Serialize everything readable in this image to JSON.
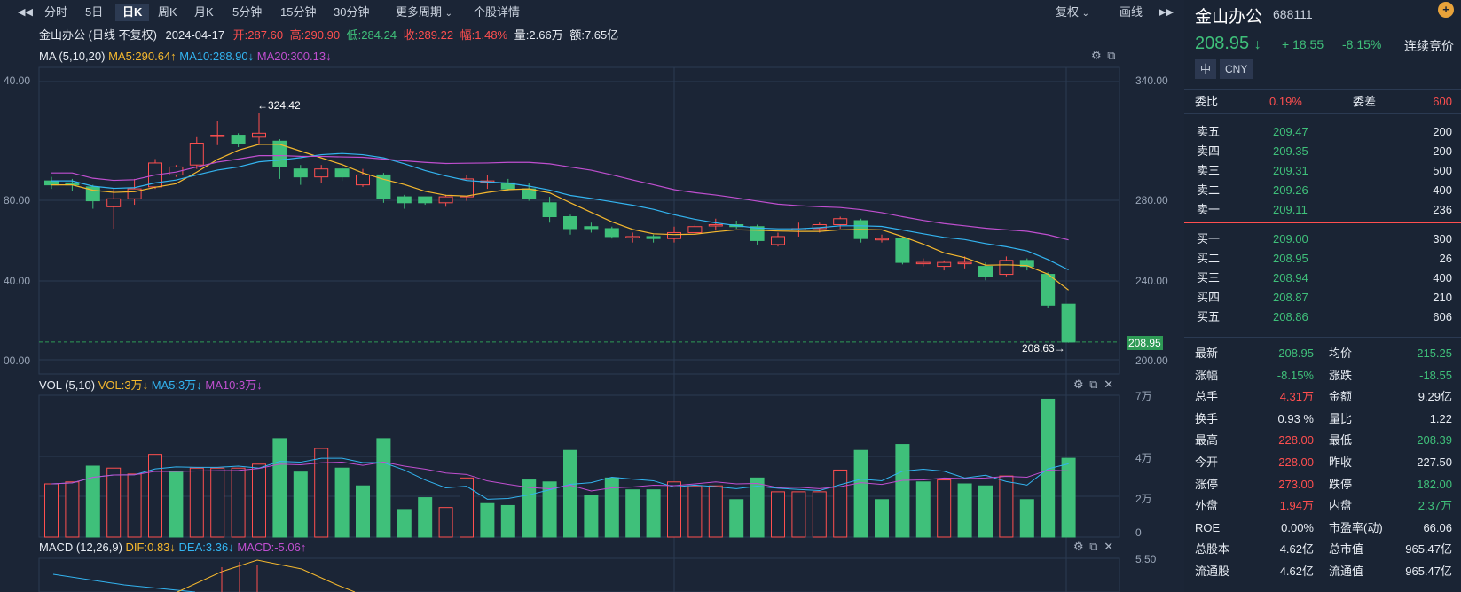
{
  "toolbar": {
    "tabs": [
      "分时",
      "5日",
      "日K",
      "周K",
      "月K",
      "5分钟",
      "15分钟",
      "30分钟"
    ],
    "more_period": "更多周期",
    "detail": "个股详情",
    "fuquan": "复权",
    "huaxian": "画线"
  },
  "info": {
    "name": "金山办公",
    "mode": "(日线 不复权)",
    "date": "2024-04-17",
    "open": "开:287.60",
    "high": "高:290.90",
    "low": "低:284.24",
    "close": "收:289.22",
    "amp": "幅:1.48%",
    "vol": "量:2.66万",
    "amt": "额:7.65亿"
  },
  "ma_header": {
    "title": "MA (5,10,20)",
    "ma5": "MA5:290.64↑",
    "ma10": "MA10:288.90↓",
    "ma20": "MA20:300.13↓"
  },
  "vol_header": {
    "title": "VOL (5,10)",
    "vol": "VOL:3万↓",
    "ma5": "MA5:3万↓",
    "ma10": "MA10:3万↓"
  },
  "macd_header": {
    "title": "MACD (12,26,9)",
    "dif": "DIF:0.83↓",
    "dea": "DEA:3.36↓",
    "macd": "MACD:-5.06↑"
  },
  "price_axis": {
    "right": [
      "340.00",
      "280.00",
      "240.00",
      "200.00"
    ],
    "left": [
      "40.00",
      "80.00",
      "40.00",
      "00.00"
    ]
  },
  "vol_axis": [
    "7万",
    "4万",
    "2万",
    "0"
  ],
  "macd_axis": [
    "5.50"
  ],
  "annotations": {
    "high_label": "←324.42",
    "low_label": "208.63→",
    "last_price_tag": "208.95"
  },
  "colors": {
    "up": "#ff4f4f",
    "down": "#3fc07a",
    "ma5": "#f5b82e",
    "ma10": "#33b4f0",
    "ma20": "#c04fd0",
    "bg": "#1b2536"
  },
  "candles": [
    {
      "o": 290,
      "c": 288,
      "h": 292,
      "l": 286
    },
    {
      "o": 289,
      "c": 288,
      "h": 291,
      "l": 285
    },
    {
      "o": 287,
      "c": 280,
      "h": 288,
      "l": 276
    },
    {
      "o": 277,
      "c": 281,
      "h": 286,
      "l": 266
    },
    {
      "o": 281,
      "c": 286,
      "h": 291,
      "l": 278
    },
    {
      "o": 287,
      "c": 299,
      "h": 301,
      "l": 286
    },
    {
      "o": 293,
      "c": 297,
      "h": 298,
      "l": 292
    },
    {
      "o": 298,
      "c": 309,
      "h": 312,
      "l": 296
    },
    {
      "o": 313,
      "c": 313,
      "h": 320,
      "l": 308
    },
    {
      "o": 313,
      "c": 309,
      "h": 314,
      "l": 307
    },
    {
      "o": 312,
      "c": 314,
      "h": 324.42,
      "l": 308
    },
    {
      "o": 310,
      "c": 297,
      "h": 311,
      "l": 291
    },
    {
      "o": 296,
      "c": 292,
      "h": 298,
      "l": 288
    },
    {
      "o": 292,
      "c": 296,
      "h": 298,
      "l": 289
    },
    {
      "o": 296,
      "c": 292,
      "h": 299,
      "l": 290
    },
    {
      "o": 288,
      "c": 293,
      "h": 296,
      "l": 287
    },
    {
      "o": 293,
      "c": 281,
      "h": 294,
      "l": 279
    },
    {
      "o": 282,
      "c": 279,
      "h": 283,
      "l": 276
    },
    {
      "o": 282,
      "c": 279,
      "h": 281,
      "l": 278
    },
    {
      "o": 279,
      "c": 282,
      "h": 283,
      "l": 277
    },
    {
      "o": 282,
      "c": 291,
      "h": 293,
      "l": 280
    },
    {
      "o": 290,
      "c": 290,
      "h": 293,
      "l": 286
    },
    {
      "o": 289,
      "c": 286,
      "h": 291,
      "l": 285
    },
    {
      "o": 286,
      "c": 281,
      "h": 289,
      "l": 280
    },
    {
      "o": 279,
      "c": 272,
      "h": 282,
      "l": 269
    },
    {
      "o": 272,
      "c": 266,
      "h": 273,
      "l": 263
    },
    {
      "o": 267,
      "c": 266,
      "h": 269,
      "l": 264
    },
    {
      "o": 266,
      "c": 262,
      "h": 267,
      "l": 261
    },
    {
      "o": 262,
      "c": 262,
      "h": 264,
      "l": 259
    },
    {
      "o": 262,
      "c": 261,
      "h": 263,
      "l": 259
    },
    {
      "o": 261,
      "c": 264,
      "h": 267,
      "l": 259
    },
    {
      "o": 264,
      "c": 267,
      "h": 268,
      "l": 263
    },
    {
      "o": 268,
      "c": 268,
      "h": 271,
      "l": 265
    },
    {
      "o": 268,
      "c": 267,
      "h": 270,
      "l": 266
    },
    {
      "o": 267,
      "c": 260,
      "h": 268,
      "l": 258
    },
    {
      "o": 258,
      "c": 262,
      "h": 264,
      "l": 257
    },
    {
      "o": 266,
      "c": 266,
      "h": 269,
      "l": 262
    },
    {
      "o": 266,
      "c": 268,
      "h": 269,
      "l": 264
    },
    {
      "o": 268,
      "c": 271,
      "h": 272,
      "l": 266
    },
    {
      "o": 270,
      "c": 261,
      "h": 271,
      "l": 259
    },
    {
      "o": 261,
      "c": 261,
      "h": 263,
      "l": 259
    },
    {
      "o": 261,
      "c": 249,
      "h": 262,
      "l": 248
    },
    {
      "o": 249,
      "c": 249,
      "h": 251,
      "l": 247
    },
    {
      "o": 247,
      "c": 249,
      "h": 250,
      "l": 245
    },
    {
      "o": 249,
      "c": 249,
      "h": 252,
      "l": 246
    },
    {
      "o": 247,
      "c": 242,
      "h": 249,
      "l": 240
    },
    {
      "o": 243,
      "c": 250,
      "h": 252,
      "l": 242
    },
    {
      "o": 250,
      "c": 247,
      "h": 251,
      "l": 245
    },
    {
      "o": 243,
      "c": 227.5,
      "h": 244,
      "l": 226
    },
    {
      "o": 228,
      "c": 208.95,
      "h": 228,
      "l": 208.63
    }
  ],
  "volumes": [
    2.7,
    2.8,
    3.6,
    3.5,
    3.2,
    4.2,
    3.3,
    3.5,
    3.5,
    3.5,
    3.7,
    5.0,
    3.3,
    4.5,
    3.5,
    2.6,
    5.0,
    1.4,
    2.0,
    1.5,
    3.0,
    1.7,
    1.6,
    2.9,
    2.8,
    4.4,
    2.1,
    3.0,
    2.4,
    2.4,
    2.8,
    2.6,
    2.6,
    1.9,
    3.0,
    2.3,
    2.3,
    2.3,
    3.4,
    4.4,
    1.9,
    4.7,
    2.8,
    2.9,
    2.7,
    2.6,
    3.1,
    1.9,
    7.0,
    4.0
  ],
  "vol_up": [
    1,
    1,
    0,
    1,
    1,
    1,
    0,
    1,
    1,
    1,
    1,
    0,
    0,
    1,
    0,
    0,
    0,
    0,
    0,
    1,
    1,
    0,
    0,
    0,
    0,
    0,
    0,
    0,
    0,
    0,
    1,
    1,
    1,
    0,
    0,
    1,
    1,
    1,
    1,
    0,
    0,
    0,
    0,
    1,
    0,
    0,
    1,
    0,
    0,
    0
  ],
  "quote": {
    "name": "金山办公",
    "code": "688111",
    "price": "208.95",
    "change": "+ 18.55",
    "change_pct": "-8.15%",
    "status": "连续竞价",
    "tag1": "中",
    "tag2": "CNY"
  },
  "weibi": {
    "label1": "委比",
    "value1": "0.19%",
    "label2": "委差",
    "value2": "600"
  },
  "asks": [
    {
      "label": "卖五",
      "price": "209.47",
      "vol": "200"
    },
    {
      "label": "卖四",
      "price": "209.35",
      "vol": "200"
    },
    {
      "label": "卖三",
      "price": "209.31",
      "vol": "500"
    },
    {
      "label": "卖二",
      "price": "209.26",
      "vol": "400"
    },
    {
      "label": "卖一",
      "price": "209.11",
      "vol": "236"
    }
  ],
  "bids": [
    {
      "label": "买一",
      "price": "209.00",
      "vol": "300"
    },
    {
      "label": "买二",
      "price": "208.95",
      "vol": "26"
    },
    {
      "label": "买三",
      "price": "208.94",
      "vol": "400"
    },
    {
      "label": "买四",
      "price": "208.87",
      "vol": "210"
    },
    {
      "label": "买五",
      "price": "208.86",
      "vol": "606"
    }
  ],
  "stats": [
    {
      "l1": "最新",
      "v1": "208.95",
      "c1": "green",
      "l2": "均价",
      "v2": "215.25",
      "c2": "green"
    },
    {
      "l1": "涨幅",
      "v1": "-8.15%",
      "c1": "green",
      "l2": "涨跌",
      "v2": "-18.55",
      "c2": "green"
    },
    {
      "l1": "总手",
      "v1": "4.31万",
      "c1": "red",
      "l2": "金额",
      "v2": "9.29亿",
      "c2": "white"
    },
    {
      "l1": "换手",
      "v1": "0.93 %",
      "c1": "white",
      "l2": "量比",
      "v2": "1.22",
      "c2": "white"
    },
    {
      "l1": "最高",
      "v1": "228.00",
      "c1": "red",
      "l2": "最低",
      "v2": "208.39",
      "c2": "green"
    },
    {
      "l1": "今开",
      "v1": "228.00",
      "c1": "red",
      "l2": "昨收",
      "v2": "227.50",
      "c2": "white"
    },
    {
      "l1": "涨停",
      "v1": "273.00",
      "c1": "red",
      "l2": "跌停",
      "v2": "182.00",
      "c2": "green"
    },
    {
      "l1": "外盘",
      "v1": "1.94万",
      "c1": "red",
      "l2": "内盘",
      "v2": "2.37万",
      "c2": "green"
    },
    {
      "l1": "ROE",
      "v1": "0.00%",
      "c1": "white",
      "l2": "市盈率(动)",
      "v2": "66.06",
      "c2": "white"
    },
    {
      "l1": "总股本",
      "v1": "4.62亿",
      "c1": "white",
      "l2": "总市值",
      "v2": "965.47亿",
      "c2": "white"
    },
    {
      "l1": "流通股",
      "v1": "4.62亿",
      "c1": "white",
      "l2": "流通值",
      "v2": "965.47亿",
      "c2": "white"
    }
  ]
}
